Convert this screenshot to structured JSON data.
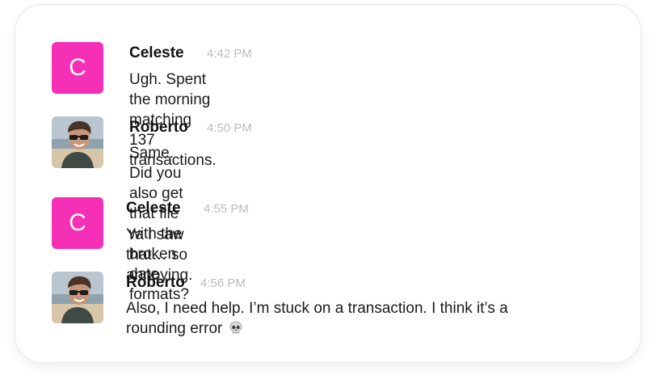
{
  "colors": {
    "initial_avatar_bg": "#f62fb7",
    "timestamp": "#bcbcbc"
  },
  "messages": [
    {
      "author": "Celeste",
      "avatar_initial": "C",
      "time": "4:42 PM",
      "text": "Ugh. Spent the morning matching 137 transactions."
    },
    {
      "author": "Roberto",
      "avatar_icon": "photo-avatar",
      "time": "4:50 PM",
      "text": "Same. Did you also get that file with the broken date formats?"
    },
    {
      "author": "Celeste",
      "avatar_initial": "C",
      "time": "4:55 PM",
      "text": "Ya I saw that… so annoying."
    },
    {
      "author": "Roberto",
      "avatar_icon": "photo-avatar",
      "time": "4:56 PM",
      "text_line1": "Also, I need help. I’m stuck on a transaction. I think it’s a",
      "text_line2": "rounding error",
      "emoji_icon": "skull-icon"
    }
  ]
}
